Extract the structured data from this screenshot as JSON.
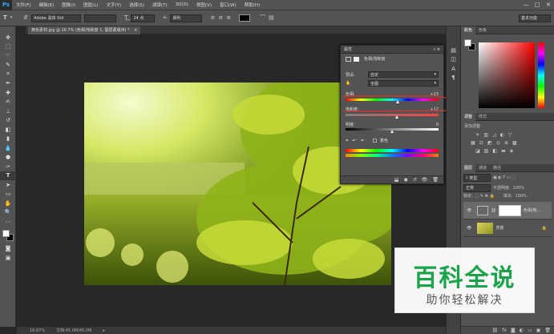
{
  "menubar": {
    "logo": "Ps",
    "items": [
      "文件(F)",
      "编辑(E)",
      "图像(I)",
      "图层(L)",
      "文字(Y)",
      "选择(S)",
      "滤镜(T)",
      "3D(D)",
      "视图(V)",
      "窗口(W)",
      "帮助(H)"
    ],
    "minimize": "—",
    "maximize": "□",
    "close": "✕"
  },
  "options": {
    "font_family": "Adobe 黑体 Std",
    "font_size": "24 点",
    "antialias": "犀利",
    "workspace": "基本功能"
  },
  "document": {
    "tab_title": "黄色素材.jpg @ 16.7% (色相/饱和度 1, 图层蒙版/8) *",
    "tab_close": "×",
    "zoom": "16.67%",
    "doc_size": "文档:45.0M/45.0M"
  },
  "properties": {
    "header": "属性",
    "title": "色相/饱和度",
    "preset_label": "预设:",
    "preset_value": "自定",
    "channel_value": "全图",
    "hue_label": "色相:",
    "hue_value": "+23",
    "hue": 23,
    "saturation_label": "饱和度:",
    "saturation_value": "+12",
    "saturation": 12,
    "lightness_label": "明度:",
    "lightness_value": "0",
    "lightness": 0,
    "colorize_label": "着色"
  },
  "panels": {
    "color_tabs": [
      "颜色",
      "色板"
    ],
    "adjust_tabs": [
      "调整",
      "样式"
    ],
    "add_adjust": "添加调整",
    "layers_tabs": [
      "图层",
      "通道",
      "路径"
    ],
    "kind_filter": "类型",
    "blend_mode": "正常",
    "opacity_label": "不透明度:",
    "opacity_value": "100%",
    "lock_label": "锁定:",
    "fill_label": "填充:",
    "fill_value": "100%",
    "layers": [
      {
        "name": "色相/饱...",
        "type": "adjustment"
      },
      {
        "name": "背景",
        "type": "image"
      }
    ]
  },
  "watermark": {
    "title": "百科全说",
    "subtitle": "助你轻松解决"
  },
  "colors": {
    "ui_dark": "#535353",
    "annotation_red": "#e03030",
    "watermark_green": "#1aa34a"
  }
}
